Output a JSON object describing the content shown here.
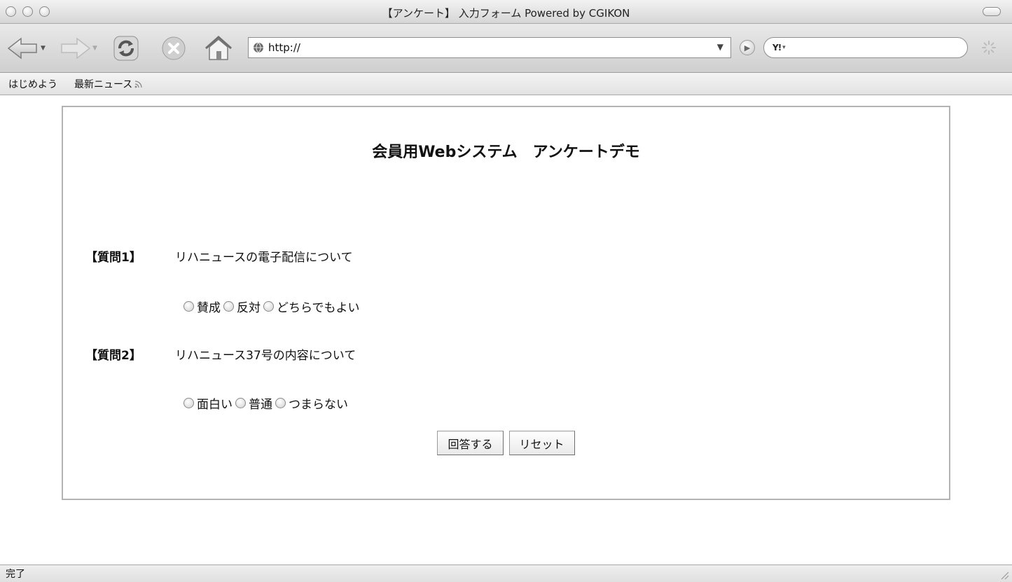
{
  "window": {
    "title": "【アンケート】 入力フォーム Powered by CGIKON"
  },
  "toolbar": {
    "address_url": "http://",
    "search_engine_label": "Y!",
    "icons": [
      "back-arrow-icon",
      "forward-arrow-icon",
      "reload-icon",
      "stop-icon",
      "home-icon",
      "globe-icon",
      "go-icon",
      "spinner-icon"
    ]
  },
  "bookmarks": {
    "items": [
      {
        "label": "はじめよう"
      },
      {
        "label": "最新ニュース"
      }
    ]
  },
  "page": {
    "title": "会員用Webシステム　アンケートデモ",
    "questions": [
      {
        "label": "【質問1】",
        "text": "リハニュースの電子配信について",
        "options": [
          "賛成",
          "反対",
          "どちらでもよい"
        ]
      },
      {
        "label": "【質問2】",
        "text": "リハニュース37号の内容について",
        "options": [
          "面白い",
          "普通",
          "つまらない"
        ]
      }
    ],
    "submit_label": "回答する",
    "reset_label": "リセット"
  },
  "status": {
    "text": "完了"
  },
  "colors": {
    "frame_border": "#b3b3b3",
    "toolbar_bg": "#dcdcdc"
  }
}
